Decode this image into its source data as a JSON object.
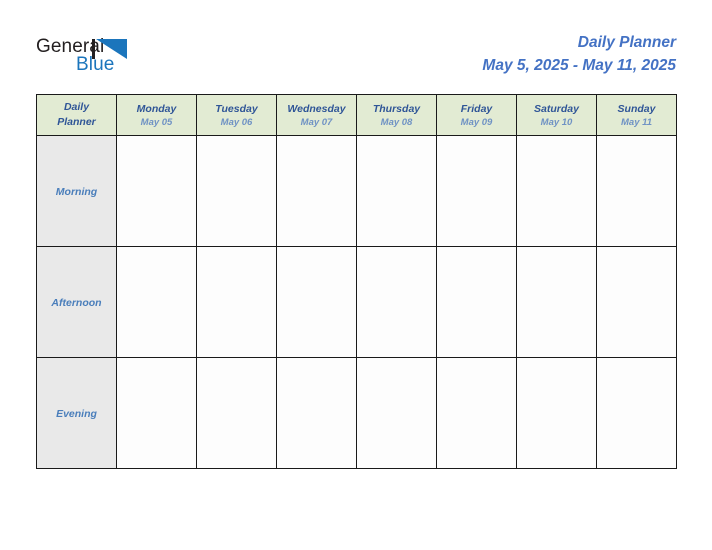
{
  "brand": {
    "line1": "General",
    "line2": "Blue",
    "mark_icon": "triangle-logo-icon",
    "text_color": "#231f20",
    "accent_color": "#1b75bc"
  },
  "header": {
    "title": "Daily Planner",
    "subtitle": "May 5, 2025 - May 11, 2025",
    "title_color": "#4472c4"
  },
  "table": {
    "corner": {
      "line1": "Daily",
      "line2": "Planner"
    },
    "header_bg": "#e2ebd3",
    "row_label_bg": "#e9e9e9",
    "cell_bg": "#fdfdfd",
    "border_color": "#1a1a1a",
    "day_color": "#2f5597",
    "date_color": "#6f92c4",
    "row_label_color": "#4a7ebb",
    "columns": [
      {
        "day": "Monday",
        "date": "May 05"
      },
      {
        "day": "Tuesday",
        "date": "May 06"
      },
      {
        "day": "Wednesday",
        "date": "May 07"
      },
      {
        "day": "Thursday",
        "date": "May 08"
      },
      {
        "day": "Friday",
        "date": "May 09"
      },
      {
        "day": "Saturday",
        "date": "May 10"
      },
      {
        "day": "Sunday",
        "date": "May 11"
      }
    ],
    "rows": [
      {
        "label": "Morning",
        "cells": [
          "",
          "",
          "",
          "",
          "",
          "",
          ""
        ]
      },
      {
        "label": "Afternoon",
        "cells": [
          "",
          "",
          "",
          "",
          "",
          "",
          ""
        ]
      },
      {
        "label": "Evening",
        "cells": [
          "",
          "",
          "",
          "",
          "",
          "",
          ""
        ]
      }
    ]
  }
}
